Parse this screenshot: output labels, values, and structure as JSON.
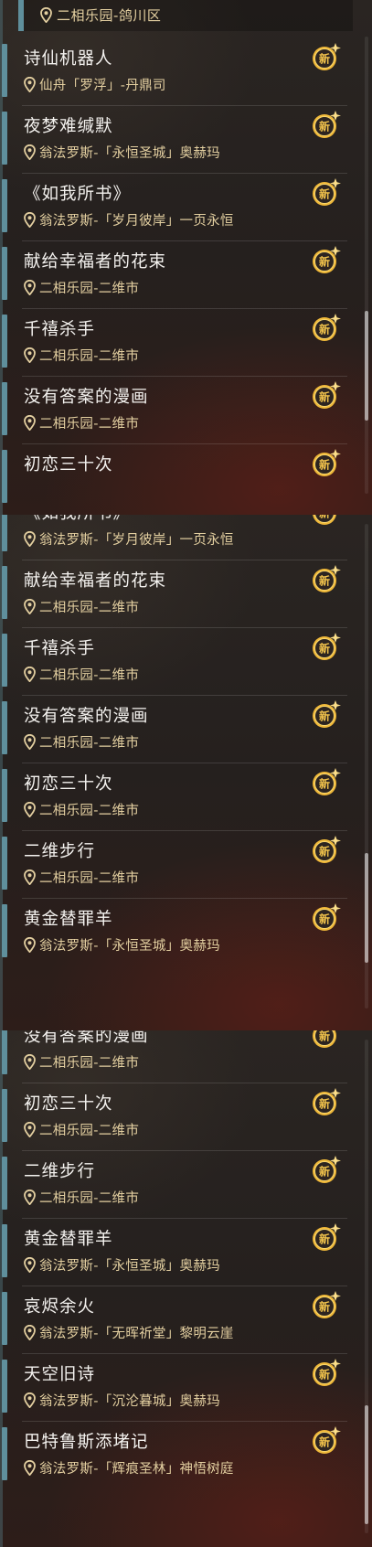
{
  "header": {
    "location": "二相乐园-鸽川区"
  },
  "badge_label": "新",
  "colors": {
    "accent_bar": "#5f8f9c",
    "location_text": "#e3cfa0",
    "badge_gold": "#f0b93a"
  },
  "panel1": [
    {
      "title": "诗仙机器人",
      "location": "仙舟「罗浮」-丹鼎司"
    },
    {
      "title": "夜梦难缄默",
      "location": "翁法罗斯-「永恒圣城」奥赫玛"
    },
    {
      "title": "《如我所书》",
      "location": "翁法罗斯-「岁月彼岸」一页永恒"
    },
    {
      "title": "献给幸福者的花束",
      "location": "二相乐园-二维市"
    },
    {
      "title": "千禧杀手",
      "location": "二相乐园-二维市"
    },
    {
      "title": "没有答案的漫画",
      "location": "二相乐园-二维市"
    },
    {
      "title": "初恋三十次",
      "location": ""
    }
  ],
  "panel2": [
    {
      "title": "《如我所书》",
      "location": "翁法罗斯-「岁月彼岸」一页永恒"
    },
    {
      "title": "献给幸福者的花束",
      "location": "二相乐园-二维市"
    },
    {
      "title": "千禧杀手",
      "location": "二相乐园-二维市"
    },
    {
      "title": "没有答案的漫画",
      "location": "二相乐园-二维市"
    },
    {
      "title": "初恋三十次",
      "location": "二相乐园-二维市"
    },
    {
      "title": "二维步行",
      "location": "二相乐园-二维市"
    },
    {
      "title": "黄金替罪羊",
      "location": "翁法罗斯-「永恒圣城」奥赫玛"
    }
  ],
  "panel3": [
    {
      "title": "没有答案的漫画",
      "location": "二相乐园-二维市"
    },
    {
      "title": "初恋三十次",
      "location": "二相乐园-二维市"
    },
    {
      "title": "二维步行",
      "location": "二相乐园-二维市"
    },
    {
      "title": "黄金替罪羊",
      "location": "翁法罗斯-「永恒圣城」奥赫玛"
    },
    {
      "title": "哀烬余火",
      "location": "翁法罗斯-「无晖祈堂」黎明云崖"
    },
    {
      "title": "天空旧诗",
      "location": "翁法罗斯-「沉沦暮城」奥赫玛"
    },
    {
      "title": "巴特鲁斯添堵记",
      "location": "翁法罗斯-「辉痕圣林」神悟树庭"
    }
  ]
}
